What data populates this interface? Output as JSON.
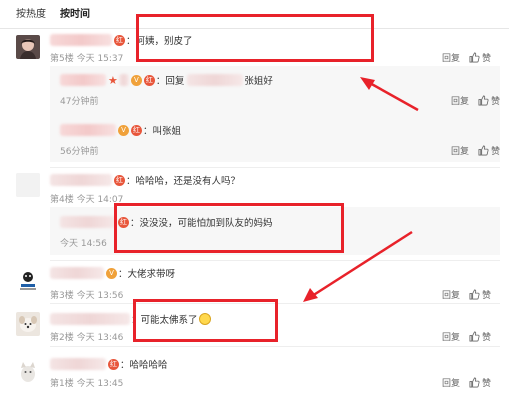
{
  "tabs": [
    "按热度",
    "按时间"
  ],
  "actions": {
    "reply": "回复",
    "like": "赞"
  },
  "colors": {
    "highlight": "#e8222a",
    "meta": "#999999",
    "badge": "#f0a13a"
  },
  "comments": [
    {
      "text": "：阿姨，别皮了",
      "meta": "第5楼 今天 15:37",
      "avatar": "avatar-girl"
    },
    {
      "text": "：回复",
      "mention": "张姐好",
      "meta": "47分钟前"
    },
    {
      "text": "：叫张姐",
      "meta": "56分钟前"
    },
    {
      "text": "：哈哈哈，还是没有人吗？",
      "meta": "第4楼 今天 14:07",
      "avatar": "avatar-blank"
    },
    {
      "text": "：没没没，可能怕加到队友的妈妈",
      "meta": "今天 14:56"
    },
    {
      "text": "：大佬求带呀",
      "meta": "第3楼 今天 13:56",
      "avatar": "avatar-cartoon"
    },
    {
      "text": "：可能太佛系了",
      "meta": "第2楼 今天 13:46",
      "avatar": "avatar-dog"
    },
    {
      "text": "：哈哈哈哈",
      "meta": "第1楼 今天 13:45",
      "avatar": "avatar-cat"
    }
  ]
}
